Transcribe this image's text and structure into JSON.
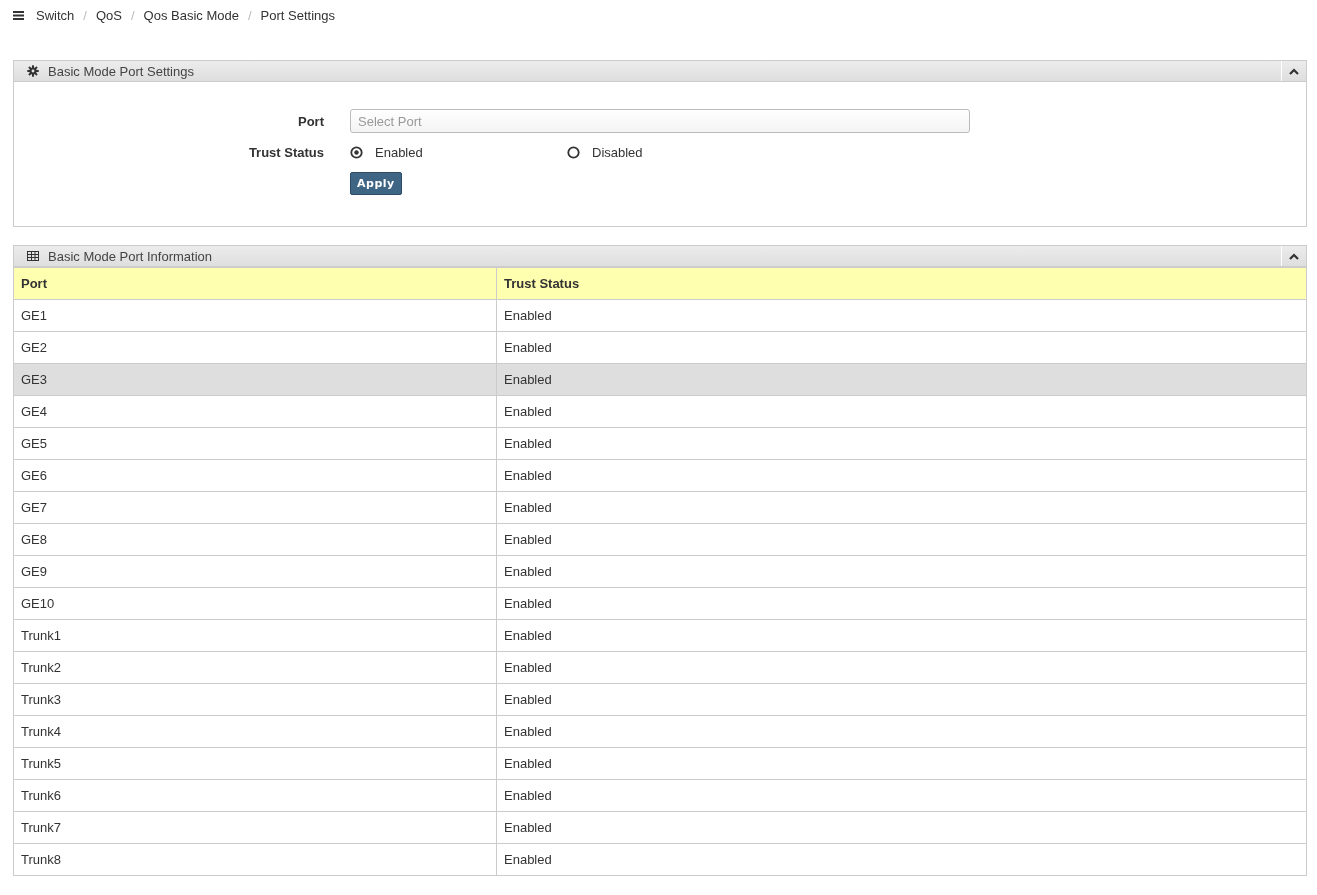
{
  "breadcrumb": [
    {
      "label": "Switch"
    },
    {
      "separator": "/",
      "label": "QoS"
    },
    {
      "separator": "/",
      "label": "Qos Basic Mode"
    },
    {
      "separator": "/",
      "label": "Port Settings"
    }
  ],
  "settings_panel": {
    "title": "Basic Mode Port Settings",
    "port_label": "Port",
    "port_placeholder": "Select Port",
    "trust_label": "Trust Status",
    "trust_options": [
      {
        "label": "Enabled",
        "selected": true
      },
      {
        "label": "Disabled",
        "selected": false
      }
    ],
    "apply": "Apply"
  },
  "info_panel": {
    "title": "Basic Mode Port Information",
    "columns": [
      "Port",
      "Trust Status"
    ],
    "rows": [
      {
        "port": "GE1",
        "trust": "Enabled",
        "highlighted": false
      },
      {
        "port": "GE2",
        "trust": "Enabled",
        "highlighted": false
      },
      {
        "port": "GE3",
        "trust": "Enabled",
        "highlighted": true
      },
      {
        "port": "GE4",
        "trust": "Enabled",
        "highlighted": false
      },
      {
        "port": "GE5",
        "trust": "Enabled",
        "highlighted": false
      },
      {
        "port": "GE6",
        "trust": "Enabled",
        "highlighted": false
      },
      {
        "port": "GE7",
        "trust": "Enabled",
        "highlighted": false
      },
      {
        "port": "GE8",
        "trust": "Enabled",
        "highlighted": false
      },
      {
        "port": "GE9",
        "trust": "Enabled",
        "highlighted": false
      },
      {
        "port": "GE10",
        "trust": "Enabled",
        "highlighted": false
      },
      {
        "port": "Trunk1",
        "trust": "Enabled",
        "highlighted": false
      },
      {
        "port": "Trunk2",
        "trust": "Enabled",
        "highlighted": false
      },
      {
        "port": "Trunk3",
        "trust": "Enabled",
        "highlighted": false
      },
      {
        "port": "Trunk4",
        "trust": "Enabled",
        "highlighted": false
      },
      {
        "port": "Trunk5",
        "trust": "Enabled",
        "highlighted": false
      },
      {
        "port": "Trunk6",
        "trust": "Enabled",
        "highlighted": false
      },
      {
        "port": "Trunk7",
        "trust": "Enabled",
        "highlighted": false
      },
      {
        "port": "Trunk8",
        "trust": "Enabled",
        "highlighted": false
      }
    ]
  }
}
